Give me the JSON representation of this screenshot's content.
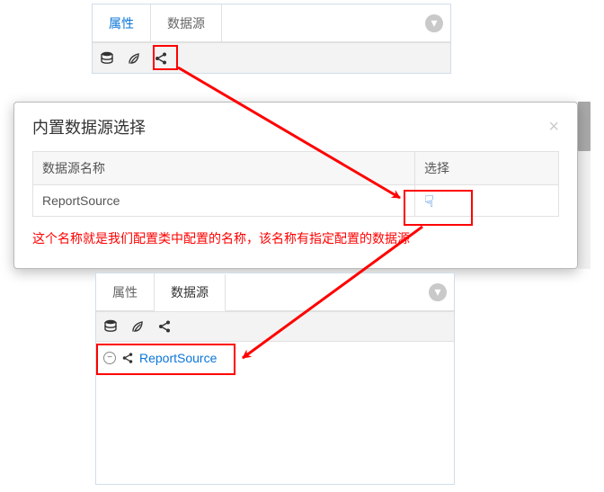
{
  "top_panel": {
    "tabs": [
      {
        "label": "属性",
        "active": true
      },
      {
        "label": "数据源",
        "active": false
      }
    ],
    "toolbar_icons": [
      "database-icon",
      "leaf-icon",
      "share-icon"
    ]
  },
  "dialog": {
    "title": "内置数据源选择",
    "columns": {
      "name": "数据源名称",
      "select": "选择"
    },
    "rows": [
      {
        "name": "ReportSource"
      }
    ],
    "note": "这个名称就是我们配置类中配置的名称，该名称有指定配置的数据源"
  },
  "bottom_panel": {
    "tabs": [
      {
        "label": "属性",
        "active": false
      },
      {
        "label": "数据源",
        "active": true
      }
    ],
    "toolbar_icons": [
      "database-icon",
      "leaf-icon",
      "share-icon"
    ],
    "tree_item": {
      "label": "ReportSource"
    }
  },
  "glyphs": {
    "collapse": "▾",
    "close": "×",
    "select_hand": "☟",
    "minus": "−"
  }
}
